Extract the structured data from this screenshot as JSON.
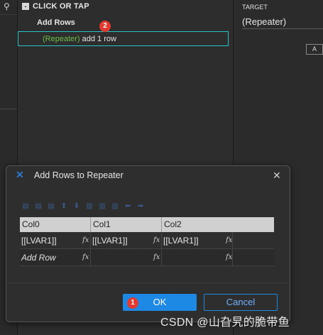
{
  "left_panel": {
    "search_icon": "search-icon"
  },
  "interaction": {
    "event_label": "CLICK OR TAP",
    "collapse_symbol": "-",
    "case_name": "Add Rows",
    "action": {
      "target": "(Repeater)",
      "text": " add 1 row"
    },
    "badge_2": "2"
  },
  "right_panel": {
    "target_label": "TARGET",
    "target_value": "(Repeater)",
    "button_label": "A"
  },
  "dialog": {
    "title": "Add Rows to Repeater",
    "close_symbol": "✕",
    "logo_symbol": "✕",
    "columns": [
      "Col0",
      "Col1",
      "Col2"
    ],
    "fx_label": "fx",
    "rows": [
      {
        "cells": [
          "[[LVAR1]]",
          "[[LVAR1]]",
          "[[LVAR1]]"
        ]
      }
    ],
    "add_row_label": "Add Row",
    "ok_label": "OK",
    "cancel_label": "Cancel",
    "badge_1": "1"
  },
  "watermark": "CSDN @山旮旯的脆带鱼",
  "colors": {
    "accent_blue": "#1e88e5",
    "highlight_cyan": "#29c3c9",
    "badge_red": "#e23a30",
    "target_green": "#6abf4b"
  }
}
